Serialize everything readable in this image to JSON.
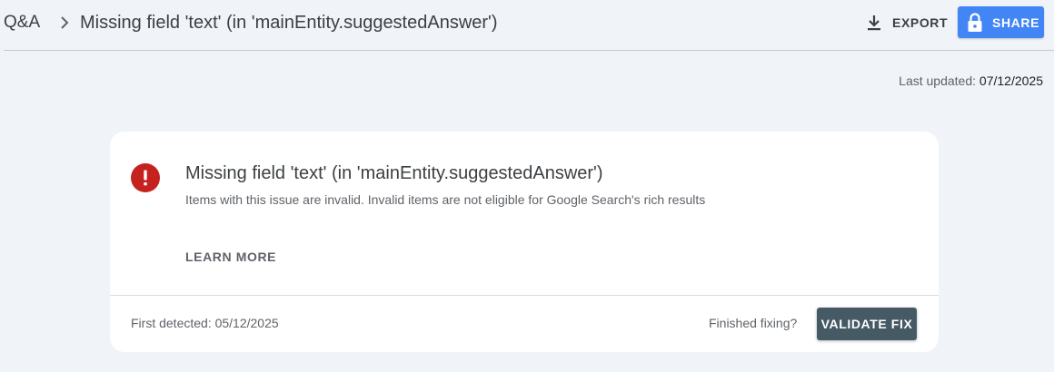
{
  "header": {
    "breadcrumb_root": "Q&A",
    "title": "Missing field 'text' (in 'mainEntity.suggestedAnswer')",
    "export_label": "EXPORT",
    "share_label": "SHARE"
  },
  "last_updated": {
    "label": "Last updated: ",
    "value": "07/12/2025"
  },
  "issue_card": {
    "title": "Missing field 'text' (in 'mainEntity.suggestedAnswer')",
    "description": "Items with this issue are invalid. Invalid items are not eligible for Google Search's rich results",
    "learn_more_label": "LEARN MORE",
    "first_detected": "First detected: 05/12/2025",
    "finished_fixing": "Finished fixing?",
    "validate_label": "VALIDATE FIX"
  },
  "colors": {
    "error": "#c5221f",
    "share_blue": "#4285f4",
    "validate_slate": "#455a64"
  }
}
